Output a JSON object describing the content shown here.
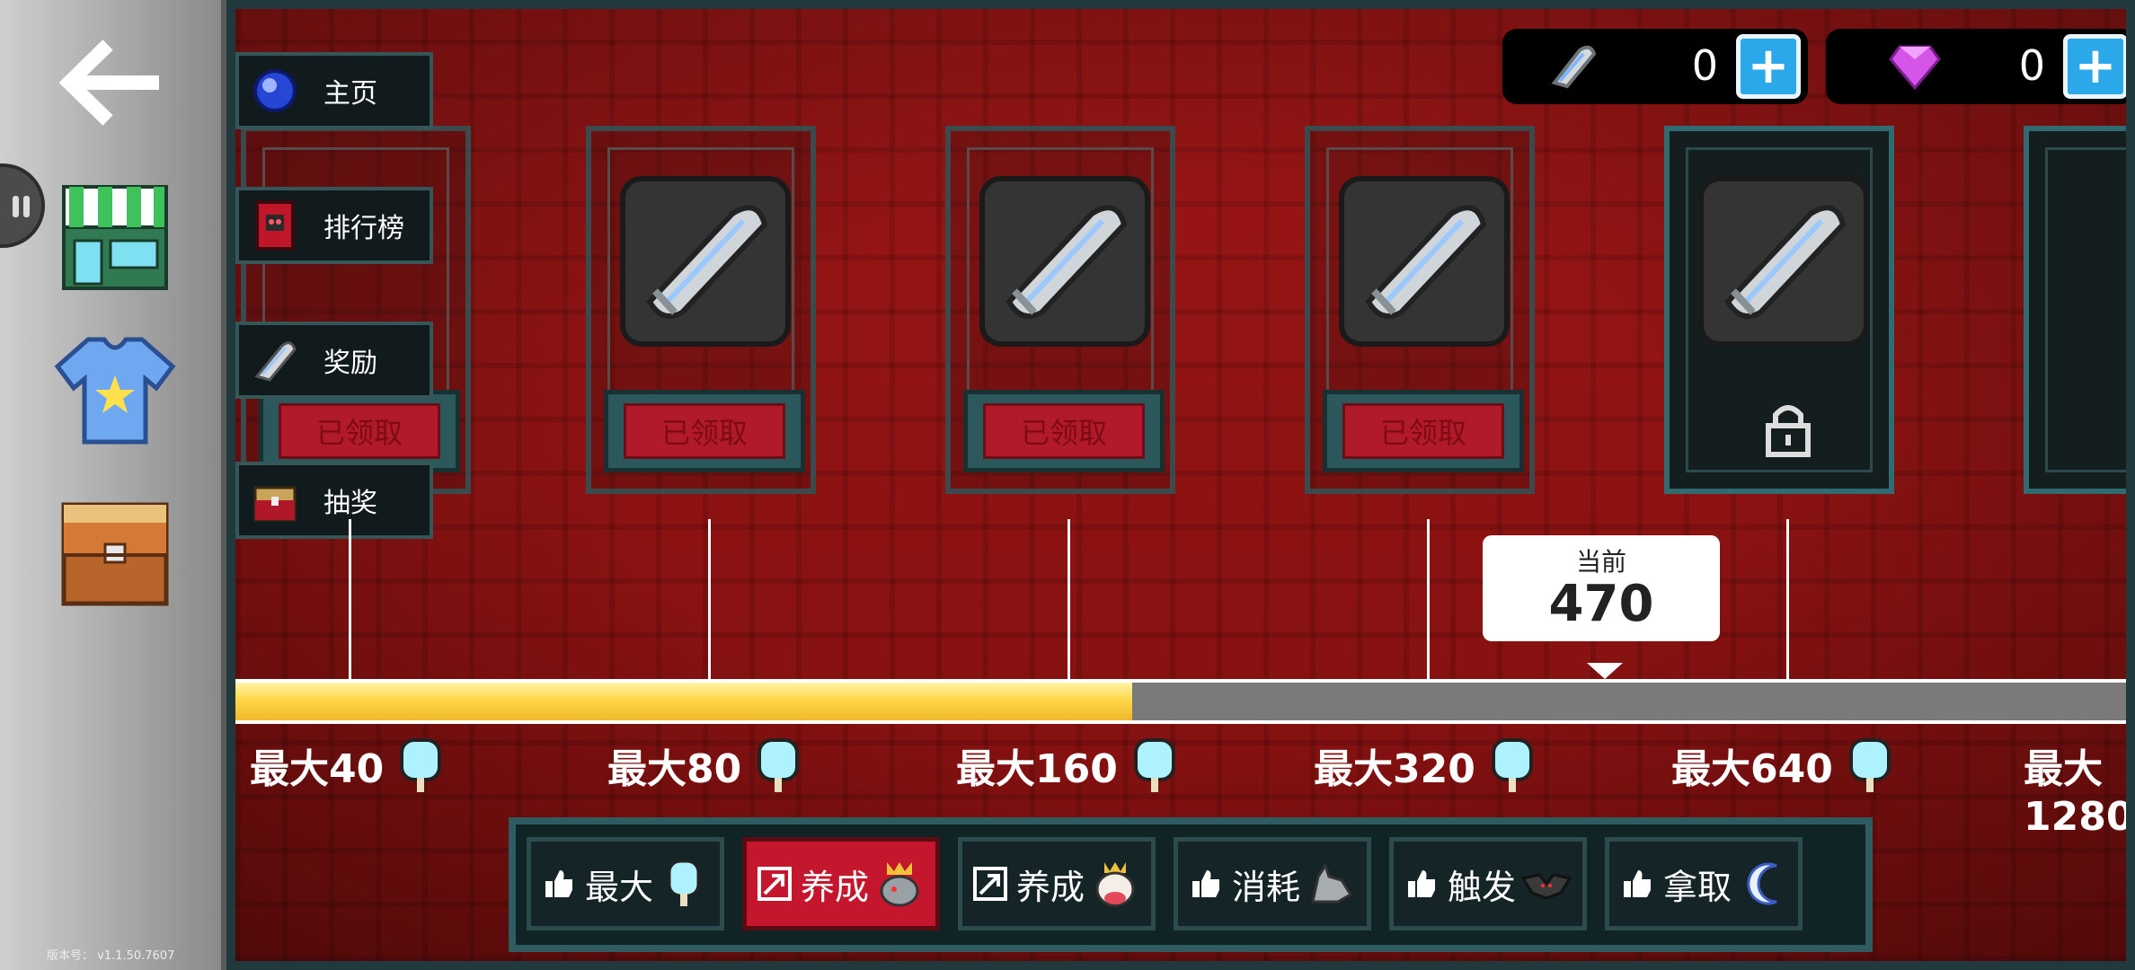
{
  "version_text": "版本号： v1.1.50.7607",
  "currency": {
    "ammo_amount": "0",
    "gem_amount": "0",
    "plus_symbol": "+"
  },
  "menu": [
    {
      "label": "主页",
      "icon": "blue-orb-icon"
    },
    {
      "label": "排行榜",
      "icon": "red-banner-icon"
    },
    {
      "label": "奖励",
      "icon": "bullet-icon"
    },
    {
      "label": "抽奖",
      "icon": "treasure-chest-icon"
    }
  ],
  "cards": [
    {
      "status": "已领取",
      "icon": "bullet-icon"
    },
    {
      "status": "已领取",
      "icon": "bullet-icon"
    },
    {
      "status": "已领取",
      "icon": "bullet-icon"
    },
    {
      "status": "已领取",
      "icon": "bullet-icon"
    },
    {
      "status": "",
      "icon": "lock-icon"
    }
  ],
  "progress": {
    "current_label": "当前",
    "current_value": "470",
    "fill_fraction": 0.47,
    "milestones": [
      "最大40",
      "最大80",
      "最大160",
      "最大320",
      "最大640",
      "最大1280"
    ]
  },
  "filters": [
    {
      "label": "最大",
      "icon": "popsicle-icon",
      "active": false
    },
    {
      "label": "养成",
      "icon": "wolf-king-icon",
      "active": true
    },
    {
      "label": "养成",
      "icon": "cow-icon",
      "active": false
    },
    {
      "label": "消耗",
      "icon": "wolf-icon",
      "active": false
    },
    {
      "label": "触发",
      "icon": "bat-icon",
      "active": false
    },
    {
      "label": "拿取",
      "icon": "crescent-moon-icon",
      "active": false
    }
  ],
  "colors": {
    "background_red": "#8c1212",
    "frame_teal": "#2e5c60",
    "progress_gold": "#ffd84a",
    "active_tab": "#c4162d",
    "plus_blue": "#2aa8ea"
  }
}
